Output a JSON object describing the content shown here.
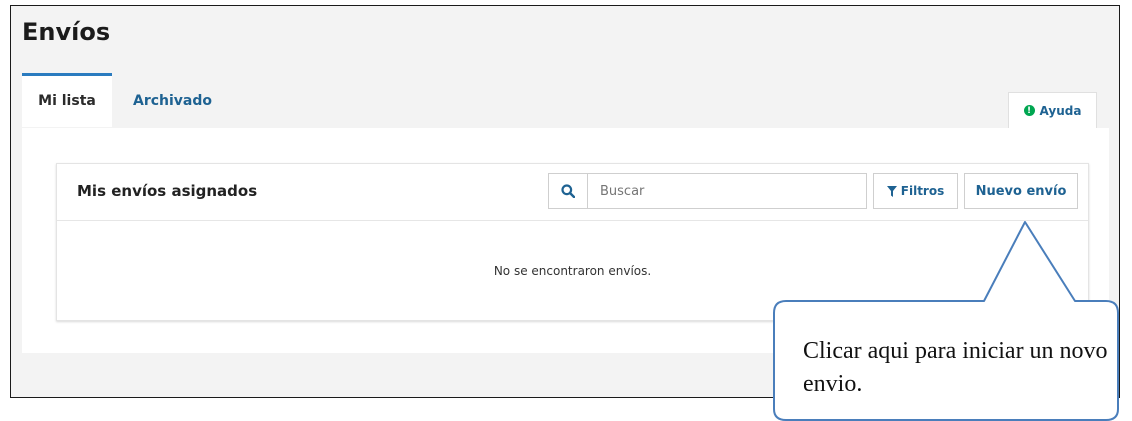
{
  "header": {
    "title": "Envíos"
  },
  "tabs": [
    {
      "label": "Mi lista",
      "active": true
    },
    {
      "label": "Archivado",
      "active": false
    }
  ],
  "help": {
    "label": "Ayuda",
    "icon": "info-circle-icon"
  },
  "card": {
    "title": "Mis envíos asignados",
    "search": {
      "placeholder": "Buscar",
      "value": "",
      "icon": "search-icon"
    },
    "filters_label": "Filtros",
    "filters_icon": "filter-icon",
    "new_button": "Nuevo envío",
    "empty_message": "No se encontraron envíos."
  },
  "callout": {
    "text": "Clicar aqui para iniciar un novo envio."
  },
  "colors": {
    "accent": "#1e6292",
    "tab_border": "#2a7bbf",
    "help_icon": "#00a651",
    "callout_border": "#4a7ebb"
  }
}
